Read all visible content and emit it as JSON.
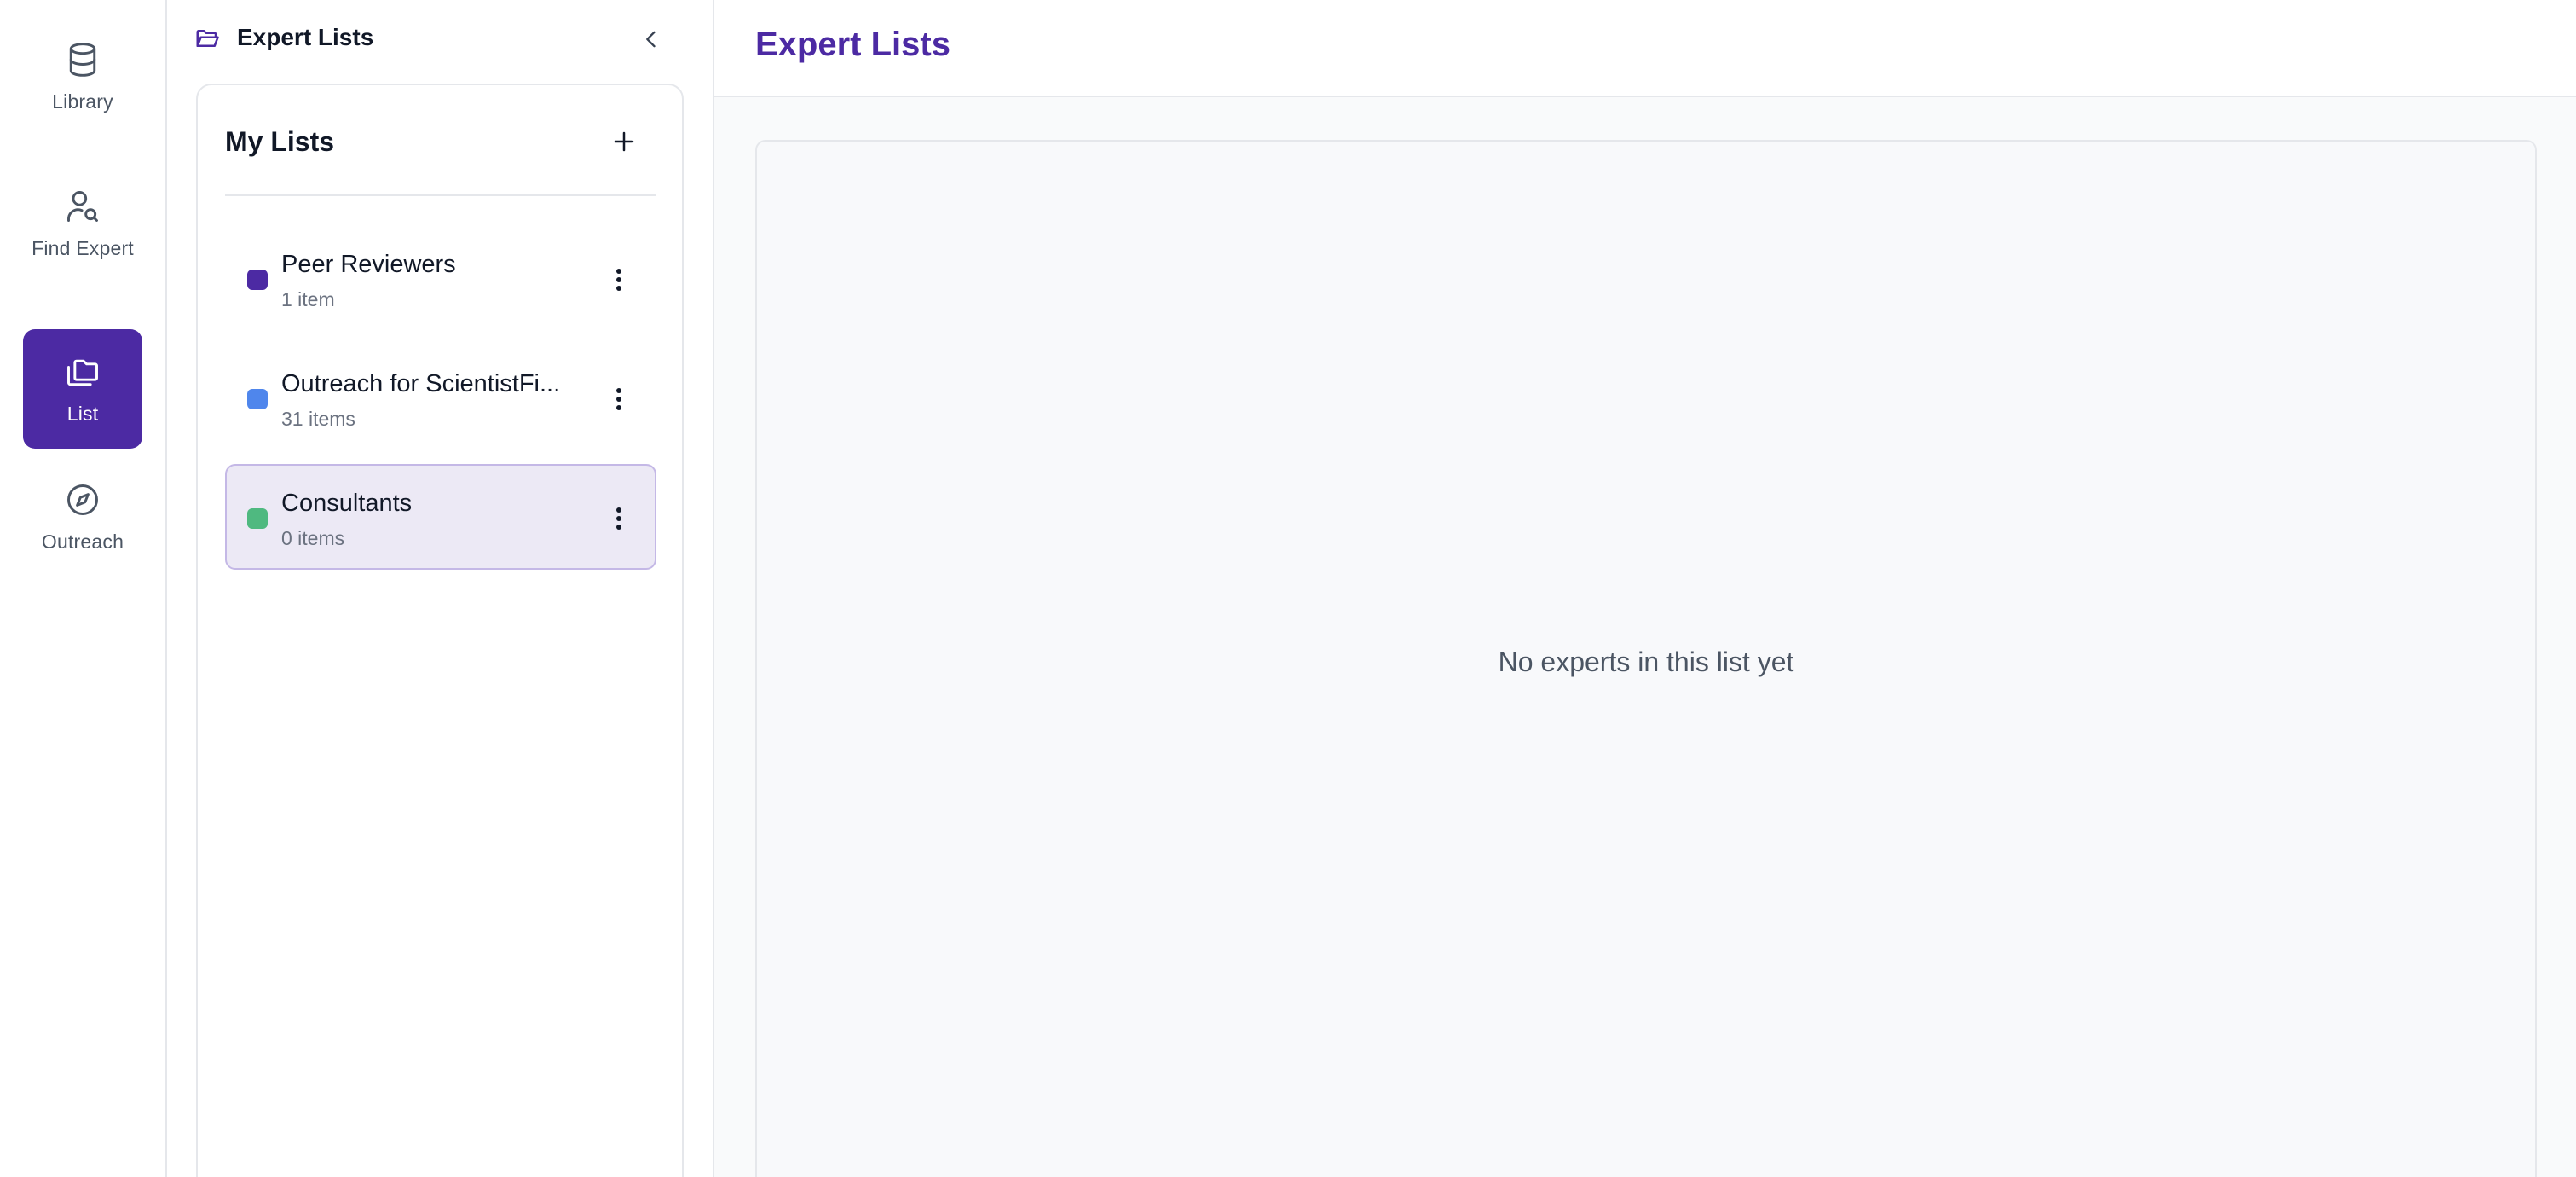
{
  "nav": {
    "items": [
      {
        "label": "Library",
        "icon": "database-icon"
      },
      {
        "label": "Find Expert",
        "icon": "user-search-icon"
      },
      {
        "label": "List",
        "icon": "folders-icon",
        "active": true
      },
      {
        "label": "Outreach",
        "icon": "compass-icon"
      }
    ]
  },
  "panel": {
    "title": "Expert Lists",
    "my_lists_label": "My Lists",
    "lists": [
      {
        "name": "Peer Reviewers",
        "count": "1 item",
        "color": "#4c2aa3"
      },
      {
        "name": "Outreach for ScientistFi...",
        "count": "31 items",
        "color": "#4f86ec"
      },
      {
        "name": "Consultants",
        "count": "0 items",
        "color": "#4fb980",
        "selected": true
      }
    ]
  },
  "main": {
    "title": "Expert Lists",
    "empty_message": "No experts in this list yet"
  },
  "colors": {
    "accent": "#4c2aa3",
    "selected_bg": "#ece9f5"
  }
}
